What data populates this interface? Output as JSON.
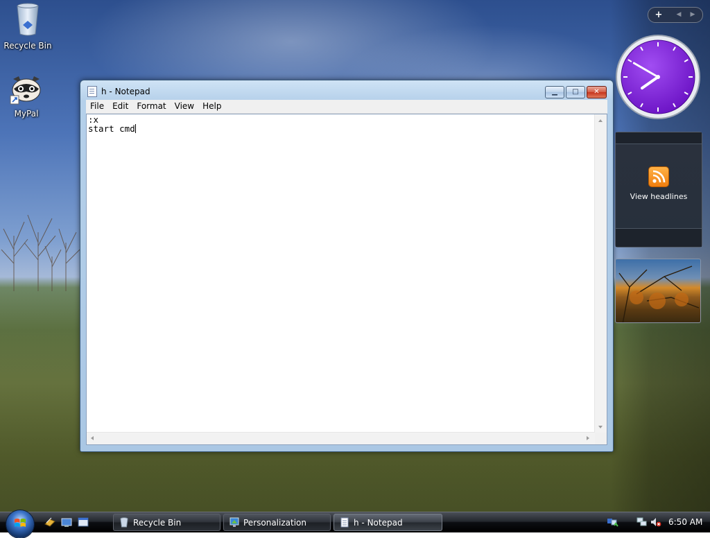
{
  "desktop": {
    "icons": [
      {
        "label": "Recycle Bin",
        "icon": "recycle-bin-icon"
      },
      {
        "label": "MyPal",
        "icon": "mypal-raccoon-icon"
      }
    ]
  },
  "notepad": {
    "title": "h - Notepad",
    "menu": [
      "File",
      "Edit",
      "Format",
      "View",
      "Help"
    ],
    "content": ":x\nstart cmd",
    "buttons": {
      "minimize": "minimize-icon",
      "maximize": "maximize-icon",
      "close": "close-icon"
    }
  },
  "sidebar": {
    "controls": {
      "add": "+",
      "prev": "◀",
      "next": "▶"
    },
    "clock_gadget": {
      "hour": 7,
      "minute": 50,
      "face_color": "#7b1fd6"
    },
    "feed_gadget": {
      "label": "View headlines",
      "icon": "rss-icon"
    },
    "slideshow_gadget": {
      "icon": "slideshow-photo"
    }
  },
  "taskbar": {
    "quick_launch": [
      "switch-windows-icon",
      "show-desktop-icon",
      "window-icon"
    ],
    "tasks": [
      {
        "label": "Recycle Bin",
        "icon": "recycle-bin-icon"
      },
      {
        "label": "Personalization",
        "icon": "personalization-icon"
      },
      {
        "label": "h - Notepad",
        "icon": "notepad-icon",
        "active": true
      }
    ],
    "tray": {
      "time": "6:50 AM"
    }
  },
  "colors": {
    "clock_face": "#7b1fd6",
    "rss_orange": "#f07d0e",
    "close_red": "#c6341c",
    "taskbar": "#1c1f24"
  }
}
